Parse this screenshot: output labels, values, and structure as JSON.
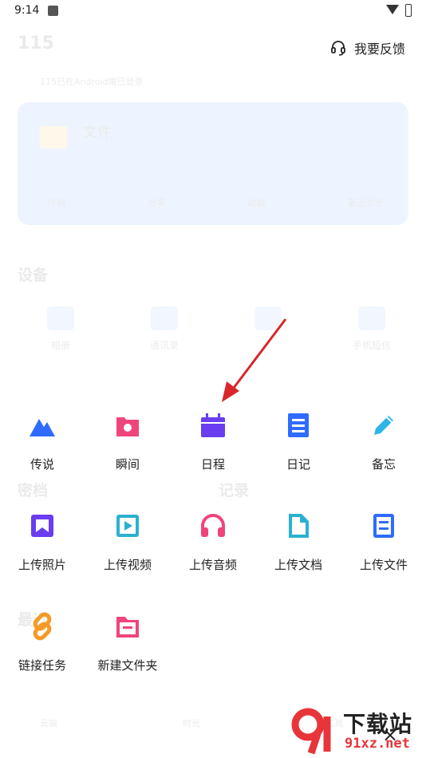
{
  "status_bar": {
    "time": "9:14"
  },
  "background": {
    "title": "115",
    "subline": "115已在Android端已登录",
    "card_title": "文件",
    "card_actions": [
      "传输",
      "分享",
      "收藏",
      "最近浏览"
    ],
    "section_devices": "设备",
    "devices": [
      "相册",
      "通讯录",
      "",
      "手机短信"
    ],
    "section_secret": "密档",
    "section_record": "记录",
    "section_recent": "最近",
    "bottom_nav": [
      "云端",
      "时光",
      "工具"
    ]
  },
  "feedback": {
    "label": "我要反馈",
    "icon": "headset-icon"
  },
  "actions": [
    [
      {
        "label": "传说",
        "icon": "mountain-icon",
        "color": "#2f6bff"
      },
      {
        "label": "瞬间",
        "icon": "photo-frame-icon",
        "color": "#f0457a"
      },
      {
        "label": "日程",
        "icon": "calendar-icon",
        "color": "#6a3df0"
      },
      {
        "label": "日记",
        "icon": "diary-icon",
        "color": "#2f6bff"
      },
      {
        "label": "备忘",
        "icon": "pencil-icon",
        "color": "#2db5e8"
      }
    ],
    [
      {
        "label": "上传照片",
        "icon": "upload-photo-icon",
        "color": "#6a3df0"
      },
      {
        "label": "上传视频",
        "icon": "upload-video-icon",
        "color": "#2bb1d0"
      },
      {
        "label": "上传音频",
        "icon": "headphones-icon",
        "color": "#f0457a"
      },
      {
        "label": "上传文档",
        "icon": "document-icon",
        "color": "#2bb1d0"
      },
      {
        "label": "上传文件",
        "icon": "file-icon",
        "color": "#2f6bff"
      }
    ],
    [
      {
        "label": "链接任务",
        "icon": "link-icon",
        "color": "#f59a24"
      },
      {
        "label": "新建文件夹",
        "icon": "new-folder-icon",
        "color": "#f0457a"
      }
    ]
  ],
  "close": {
    "label": "×",
    "icon": "close-icon"
  },
  "watermark": {
    "brand": "下载站",
    "domain": "91xz.net"
  }
}
